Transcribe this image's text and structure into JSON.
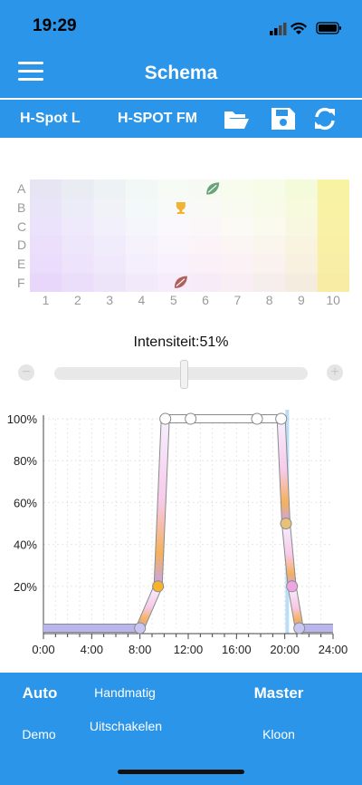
{
  "status_bar": {
    "time": "19:29"
  },
  "nav": {
    "title": "Schema"
  },
  "toolbar": {
    "device": "H-Spot L",
    "program": "H-SPOT FM",
    "icons": [
      "folder-open-icon",
      "save-icon",
      "refresh-icon"
    ]
  },
  "matrix": {
    "rows": [
      "A",
      "B",
      "C",
      "D",
      "E",
      "F"
    ],
    "cols": [
      "1",
      "2",
      "3",
      "4",
      "5",
      "6",
      "7",
      "8",
      "9",
      "10"
    ],
    "markers": [
      {
        "icon": "leaf-icon",
        "row": "A",
        "col": "6",
        "color": "#6aa37a"
      },
      {
        "icon": "trophy-icon",
        "row": "B",
        "col": "5",
        "color": "#f2b233"
      },
      {
        "icon": "leaf-icon",
        "row": "F",
        "col": "5",
        "color": "#b0605a"
      }
    ]
  },
  "intensity": {
    "label": "Intensiteit:51%",
    "value": 0.51
  },
  "chart_data": {
    "type": "line",
    "x_ticks": [
      "0:00",
      "4:00",
      "8:00",
      "12:00",
      "16:00",
      "20:00",
      "24:00"
    ],
    "y_ticks": [
      "100%",
      "80%",
      "60%",
      "40%",
      "20%"
    ],
    "xlim": [
      0,
      24
    ],
    "ylim": [
      0,
      100
    ],
    "points": [
      {
        "x": 0,
        "y": 0
      },
      {
        "x": 8,
        "y": 0
      },
      {
        "x": 9.5,
        "y": 20
      },
      {
        "x": 10.1,
        "y": 100
      },
      {
        "x": 12.2,
        "y": 100
      },
      {
        "x": 17.7,
        "y": 100
      },
      {
        "x": 19.7,
        "y": 100
      },
      {
        "x": 20.1,
        "y": 50
      },
      {
        "x": 20.6,
        "y": 20
      },
      {
        "x": 21.2,
        "y": 0
      },
      {
        "x": 24,
        "y": 0
      }
    ],
    "current_time": 20.2,
    "grid": true
  },
  "tabs": {
    "auto": "Auto",
    "manual": "Handmatig",
    "master": "Master",
    "demo": "Demo",
    "off": "Uitschakelen",
    "clone": "Kloon"
  }
}
